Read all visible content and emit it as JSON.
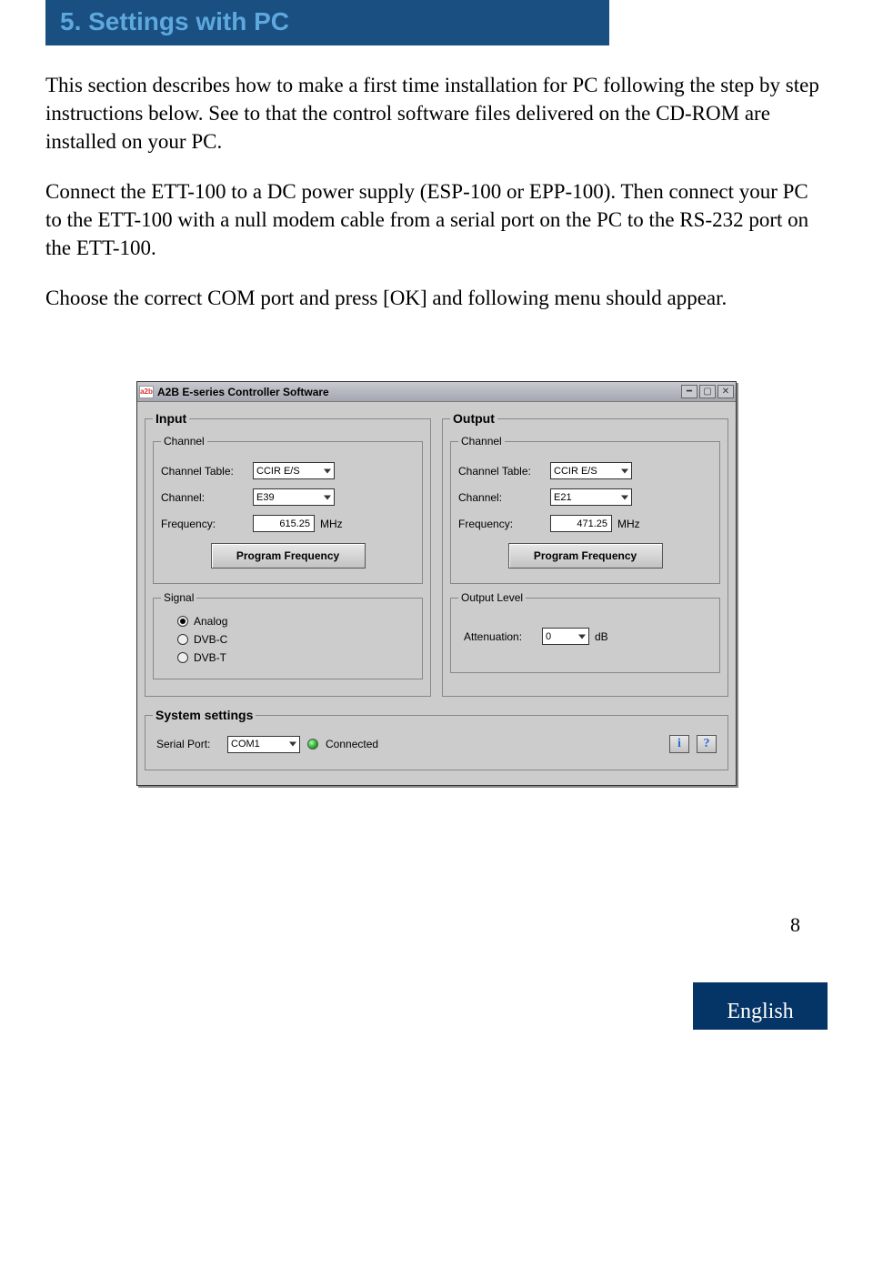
{
  "page": {
    "section_title": "5. Settings with PC",
    "para1": "This section describes how to make a first time installation for PC following the step by step instructions below. See to that the control software files delivered on the CD-ROM are installed on your PC.",
    "para2": "Connect the ETT-100 to a DC power supply (ESP-100 or EPP-100). Then connect your PC to the ETT-100 with a null modem cable from a serial port on the PC to the RS-232 port on the ETT-100.",
    "para3": "Choose the correct COM port and press [OK] and following menu should appear.",
    "page_number": "8",
    "language": "English"
  },
  "window": {
    "app_icon_text": "a2b",
    "title": "A2B E-series Controller Software",
    "input": {
      "legend": "Input",
      "channel": {
        "legend": "Channel",
        "table_label": "Channel Table:",
        "table_value": "CCIR E/S",
        "channel_label": "Channel:",
        "channel_value": "E39",
        "freq_label": "Frequency:",
        "freq_value": "615.25",
        "freq_unit": "MHz",
        "program_btn": "Program Frequency"
      },
      "signal": {
        "legend": "Signal",
        "options": [
          "Analog",
          "DVB-C",
          "DVB-T"
        ],
        "selected": "Analog"
      }
    },
    "output": {
      "legend": "Output",
      "channel": {
        "legend": "Channel",
        "table_label": "Channel Table:",
        "table_value": "CCIR E/S",
        "channel_label": "Channel:",
        "channel_value": "E21",
        "freq_label": "Frequency:",
        "freq_value": "471.25",
        "freq_unit": "MHz",
        "program_btn": "Program Frequency"
      },
      "level": {
        "legend": "Output Level",
        "att_label": "Attenuation:",
        "att_value": "0",
        "att_unit": "dB"
      }
    },
    "system": {
      "legend": "System settings",
      "serial_label": "Serial Port:",
      "serial_value": "COM1",
      "status": "Connected",
      "info_icon": "i",
      "help_icon": "?"
    }
  }
}
